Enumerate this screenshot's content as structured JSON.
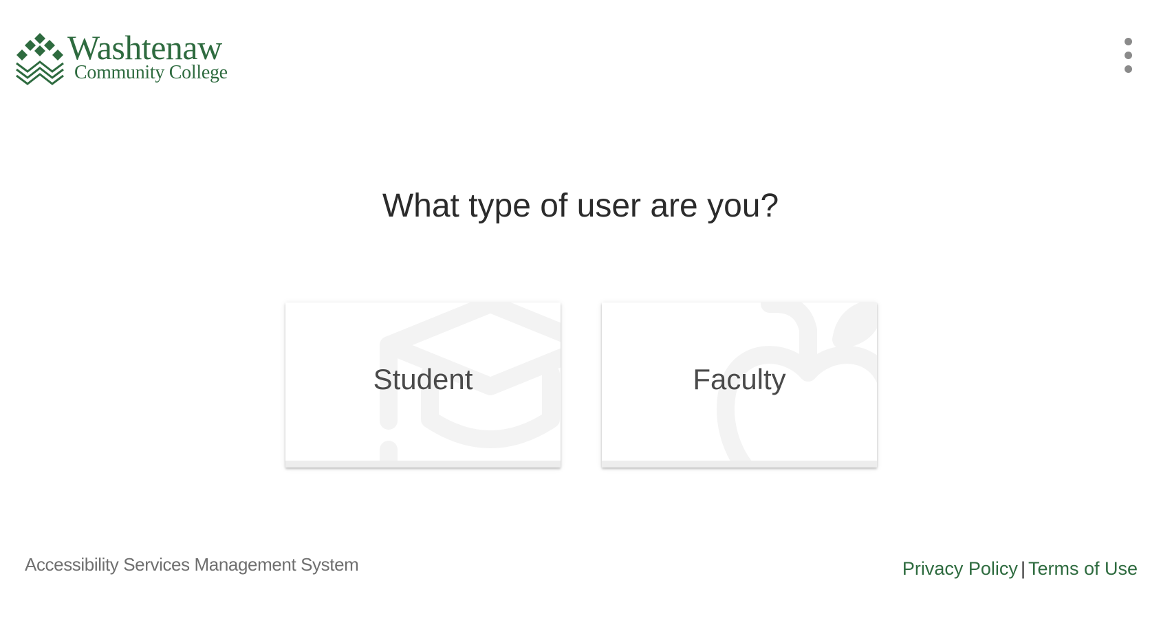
{
  "header": {
    "logo": {
      "line1": "Washtenaw",
      "line2": "Community College",
      "color": "#2e6b3f"
    },
    "menu_icon": "more-vertical-icon"
  },
  "main": {
    "question": "What type of user are you?",
    "options": [
      {
        "label": "Student",
        "icon": "graduation-cap-icon"
      },
      {
        "label": "Faculty",
        "icon": "apple-icon"
      }
    ]
  },
  "footer": {
    "system_name": "Accessibility Services Management System",
    "links": {
      "privacy": "Privacy Policy",
      "separator": "|",
      "terms": "Terms of Use"
    },
    "link_color": "#2e6b3f"
  }
}
